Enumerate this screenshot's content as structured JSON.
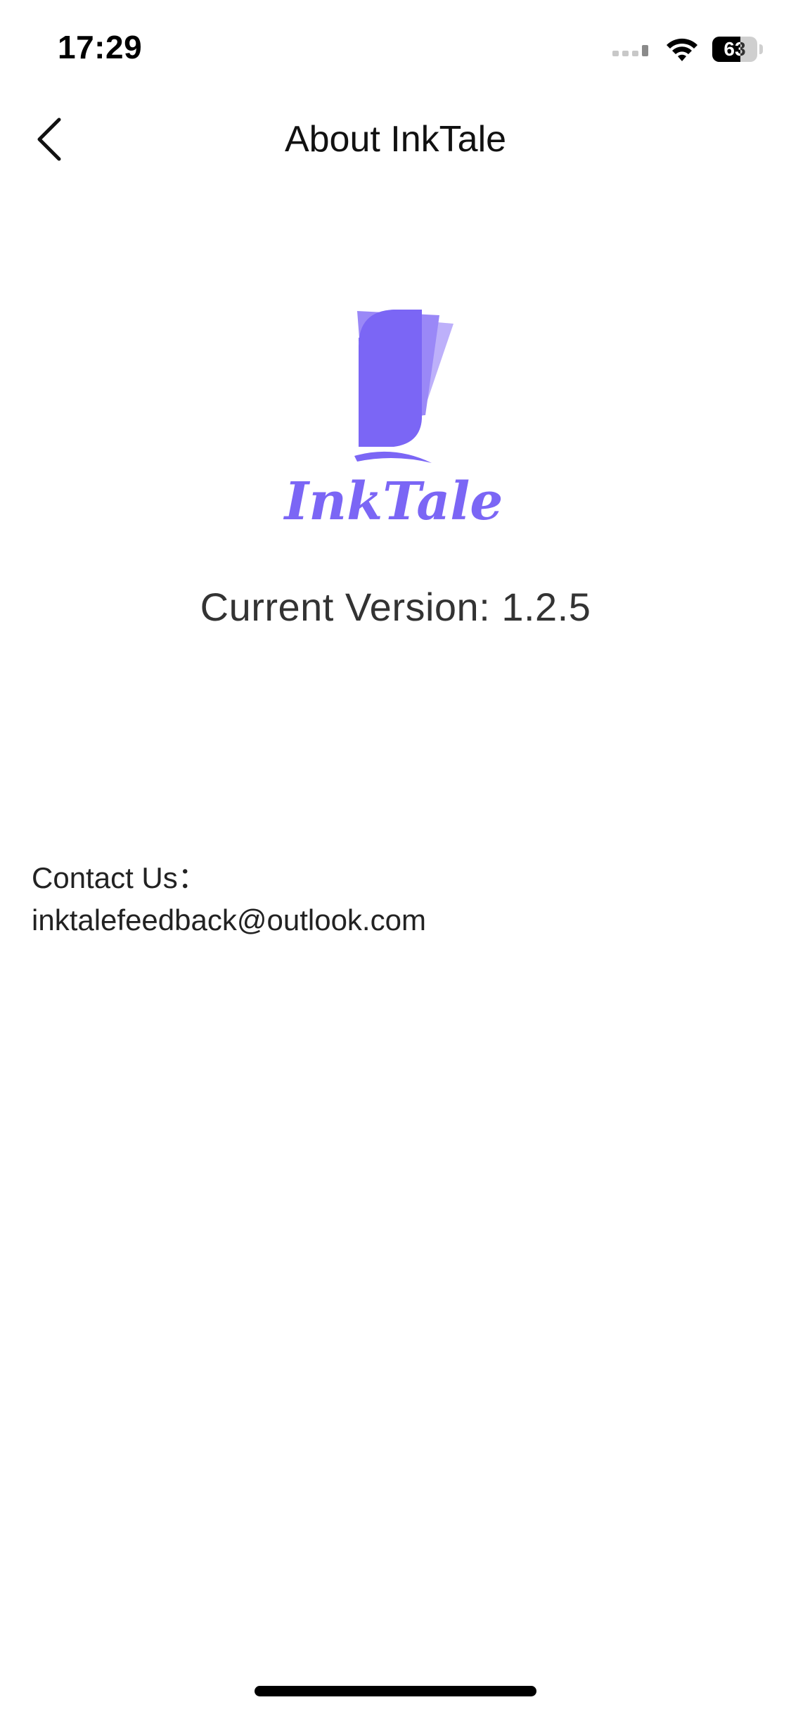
{
  "status_bar": {
    "time": "17:29",
    "battery": "63",
    "battery_level": 0.63,
    "icons": [
      "signal-icon",
      "wifi-icon",
      "battery-icon"
    ]
  },
  "nav": {
    "title": "About InkTale",
    "back_icon": "chevron-left-icon"
  },
  "logo": {
    "brand": "InkTale",
    "colors": {
      "primary": "#7B66F5",
      "secondary": "#9A88F7",
      "tertiary": "#BDB0FA"
    }
  },
  "version_text": "Current Version: 1.2.5",
  "contact": {
    "label": "Contact Us：",
    "email": "inktalefeedback@outlook.com"
  }
}
